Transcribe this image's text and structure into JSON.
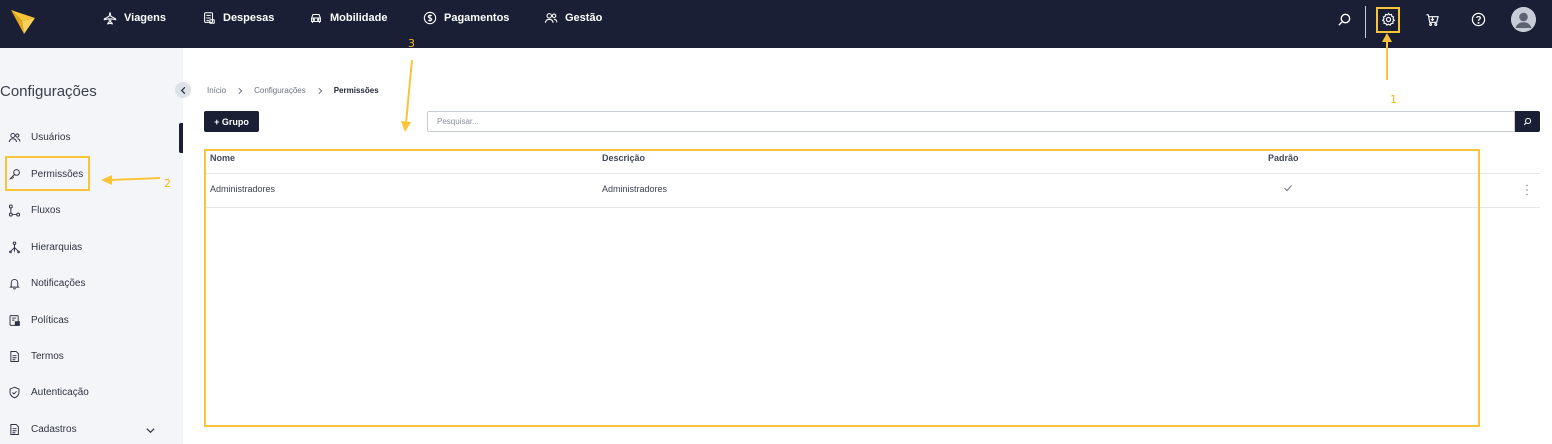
{
  "topbar": {
    "nav": [
      {
        "label": "Viagens",
        "icon": "plane-icon"
      },
      {
        "label": "Despesas",
        "icon": "receipt-icon"
      },
      {
        "label": "Mobilidade",
        "icon": "car-icon"
      },
      {
        "label": "Pagamentos",
        "icon": "dollar-icon"
      },
      {
        "label": "Gestão",
        "icon": "users-icon"
      }
    ],
    "icons": [
      "search-icon",
      "gear-icon",
      "cart-icon",
      "help-icon",
      "avatar-icon"
    ]
  },
  "sidebar": {
    "title": "Configurações",
    "items": [
      {
        "label": "Usuários",
        "icon": "users-icon"
      },
      {
        "label": "Permissões",
        "icon": "key-icon"
      },
      {
        "label": "Fluxos",
        "icon": "flow-icon"
      },
      {
        "label": "Hierarquias",
        "icon": "hierarchy-icon"
      },
      {
        "label": "Notificações",
        "icon": "bell-icon"
      },
      {
        "label": "Políticas",
        "icon": "policy-icon"
      },
      {
        "label": "Termos",
        "icon": "document-icon"
      },
      {
        "label": "Autenticação",
        "icon": "shield-icon"
      },
      {
        "label": "Cadastros",
        "icon": "file-icon"
      }
    ]
  },
  "breadcrumb": {
    "items": [
      "Início",
      "Configurações",
      "Permissões"
    ]
  },
  "toolbar": {
    "add_label": "+ Grupo",
    "search_placeholder": "Pesquisar..."
  },
  "table": {
    "columns": [
      "Nome",
      "Descrição",
      "Padrão"
    ],
    "rows": [
      {
        "nome": "Administradores",
        "descricao": "Administradores",
        "padrao": true
      }
    ]
  },
  "annotations": [
    "1",
    "2",
    "3"
  ],
  "colors": {
    "topbar": "#1a1f36",
    "highlight": "#f9c437",
    "sidebar_bg": "#f3f5f8",
    "logo": "#f9c437"
  }
}
